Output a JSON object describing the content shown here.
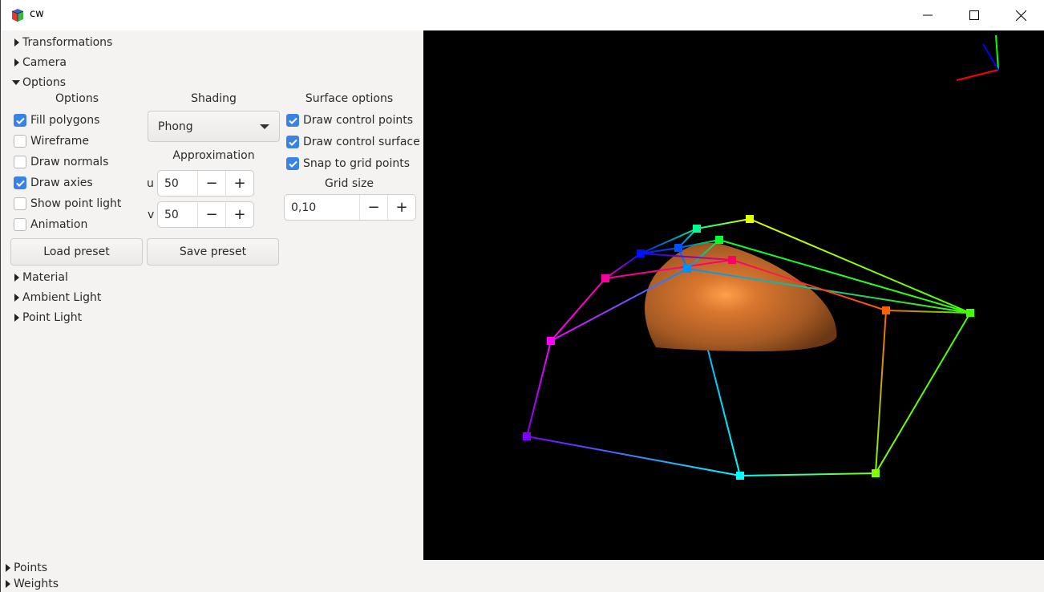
{
  "window": {
    "title": "cw",
    "app_icon": "rubik-cube-icon",
    "controls": {
      "minimize": "minimize-icon",
      "maximize": "maximize-icon",
      "close": "close-icon"
    }
  },
  "sections": {
    "transformations": {
      "label": "Transformations",
      "expanded": false
    },
    "camera": {
      "label": "Camera",
      "expanded": false
    },
    "options": {
      "label": "Options",
      "expanded": true
    },
    "material": {
      "label": "Material",
      "expanded": false
    },
    "ambient_light": {
      "label": "Ambient Light",
      "expanded": false
    },
    "point_light": {
      "label": "Point Light",
      "expanded": false
    },
    "points": {
      "label": "Points",
      "expanded": false
    },
    "weights": {
      "label": "Weights",
      "expanded": false
    }
  },
  "options": {
    "header": "Options",
    "checkboxes": [
      {
        "label": "Fill polygons",
        "checked": true
      },
      {
        "label": "Wireframe",
        "checked": false
      },
      {
        "label": "Draw normals",
        "checked": false
      },
      {
        "label": "Draw axies",
        "checked": true
      },
      {
        "label": "Show point light",
        "checked": false
      },
      {
        "label": "Animation",
        "checked": false
      }
    ]
  },
  "shading": {
    "header": "Shading",
    "selected": "Phong",
    "approximation_header": "Approximation",
    "u": {
      "label": "u",
      "value": "50"
    },
    "v": {
      "label": "v",
      "value": "50"
    },
    "minus": "−",
    "plus": "+"
  },
  "surface_options": {
    "header": "Surface options",
    "checkboxes": [
      {
        "label": "Draw control points",
        "checked": true
      },
      {
        "label": "Draw control surface",
        "checked": true
      },
      {
        "label": "Snap to grid points",
        "checked": true
      }
    ],
    "grid_size_header": "Grid size",
    "grid_size_value": "0,10"
  },
  "buttons": {
    "load_preset": "Load preset",
    "save_preset": "Save preset"
  },
  "scene": {
    "background": "#000000",
    "surface_color": "#c0642a",
    "surface_highlight": "#ff9a45",
    "axes": [
      {
        "name": "x-axis",
        "color": "#ff0000"
      },
      {
        "name": "y-axis",
        "color": "#00ff00"
      },
      {
        "name": "z-axis",
        "color": "#0000ff"
      }
    ],
    "control_points": [
      {
        "id": "p00",
        "color": "#8000ff"
      },
      {
        "id": "p01",
        "color": "#ff00ff"
      },
      {
        "id": "p02",
        "color": "#ff00a0"
      },
      {
        "id": "p03",
        "color": "#0010ff"
      },
      {
        "id": "p10",
        "color": "#00ffff"
      },
      {
        "id": "p11",
        "color": "#0090ff"
      },
      {
        "id": "p12",
        "color": "#0050ff"
      },
      {
        "id": "p13",
        "color": "#00ff90"
      },
      {
        "id": "p20",
        "color": "#80ff00"
      },
      {
        "id": "p21",
        "color": "#ff6000"
      },
      {
        "id": "p22",
        "color": "#ff0060"
      },
      {
        "id": "p23",
        "color": "#00ff30"
      },
      {
        "id": "p30",
        "color": "#40ff00"
      },
      {
        "id": "p33",
        "color": "#e0ff00"
      }
    ]
  }
}
